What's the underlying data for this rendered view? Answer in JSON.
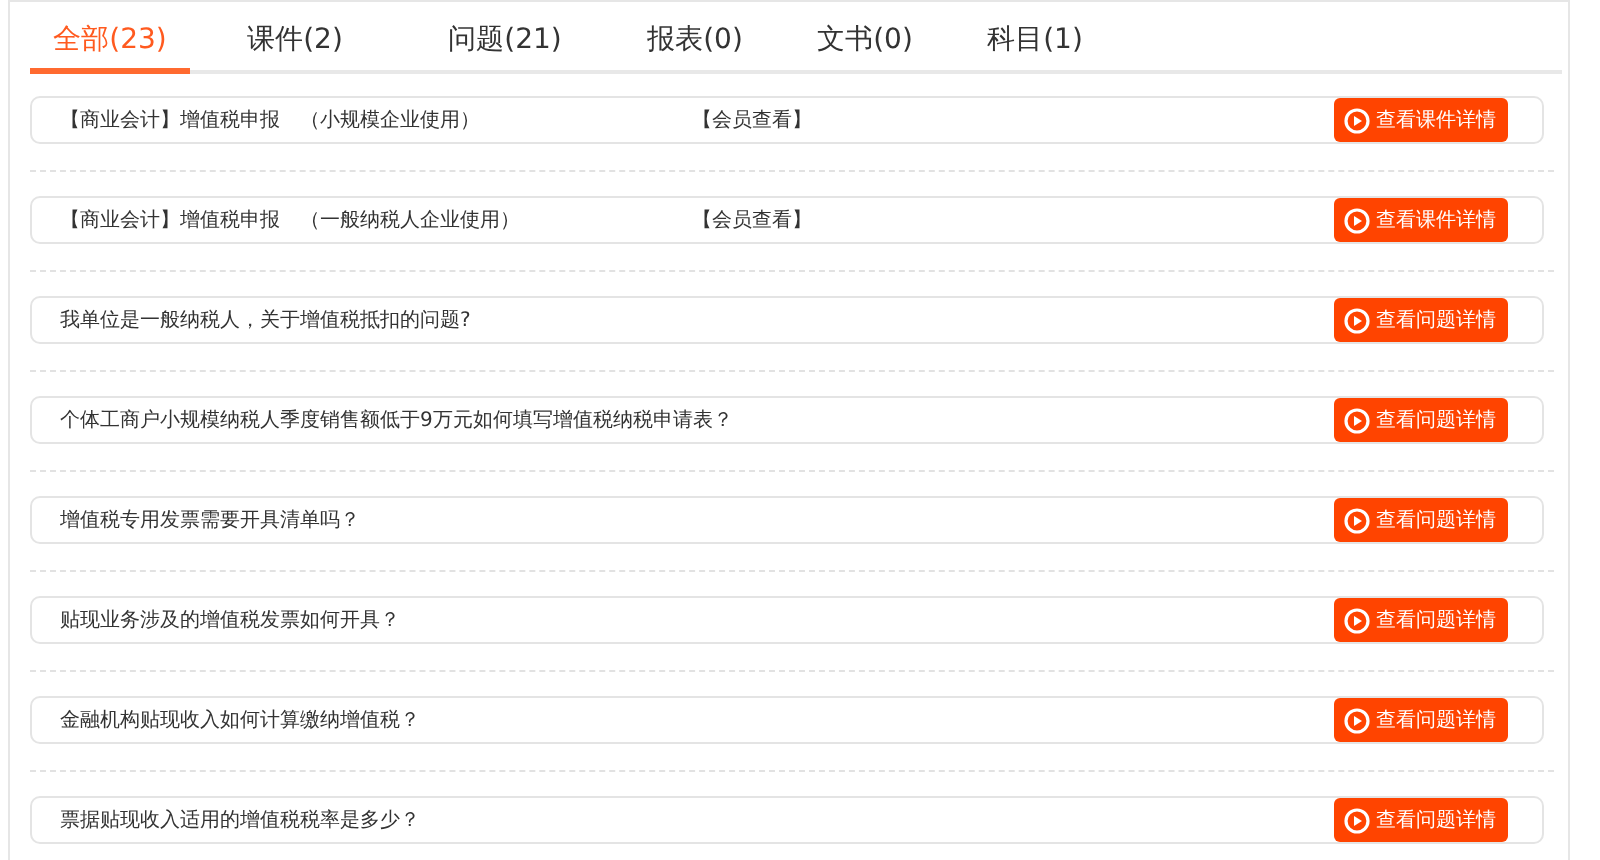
{
  "tabs": [
    {
      "label": "全部(23)",
      "selected": true
    },
    {
      "label": "课件(2)",
      "selected": false
    },
    {
      "label": "问题(21)",
      "selected": false
    },
    {
      "label": "报表(0)",
      "selected": false
    },
    {
      "label": "文书(0)",
      "selected": false
    },
    {
      "label": "科目(1)",
      "selected": false
    }
  ],
  "items": [
    {
      "title": "【商业会计】增值税申报　（小规模企业使用）",
      "tag": "【会员查看】",
      "button": "查看课件详情"
    },
    {
      "title": "【商业会计】增值税申报　（一般纳税人企业使用）",
      "tag": "【会员查看】",
      "button": "查看课件详情"
    },
    {
      "title": "我单位是一般纳税人，关于增值税抵扣的问题?",
      "button": "查看问题详情"
    },
    {
      "title": "个体工商户小规模纳税人季度销售额低于9万元如何填写增值税纳税申请表？",
      "button": "查看问题详情"
    },
    {
      "title": "增值税专用发票需要开具清单吗？",
      "button": "查看问题详情"
    },
    {
      "title": "贴现业务涉及的增值税发票如何开具？",
      "button": "查看问题详情"
    },
    {
      "title": "金融机构贴现收入如何计算缴纳增值税？",
      "button": "查看问题详情"
    },
    {
      "title": "票据贴现收入适用的增值税税率是多少？",
      "button": "查看问题详情"
    }
  ]
}
